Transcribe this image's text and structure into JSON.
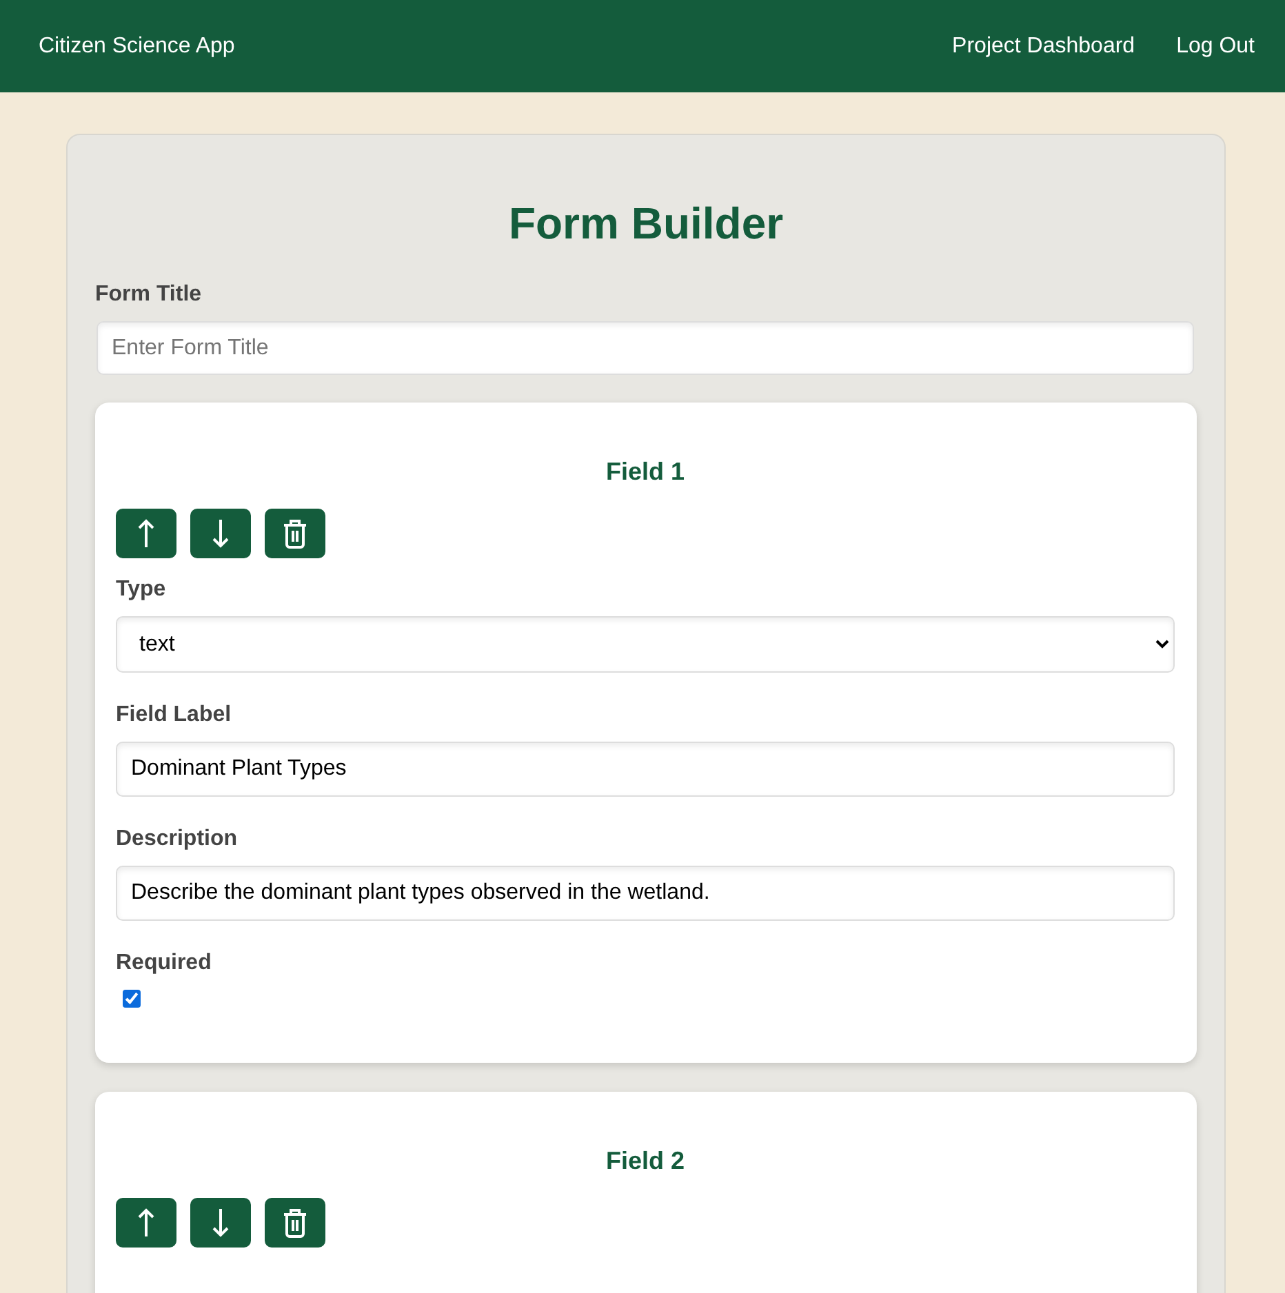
{
  "navbar": {
    "brand": "Citizen Science App",
    "links": [
      "Project Dashboard",
      "Log Out"
    ]
  },
  "title": "Form Builder",
  "form_title": {
    "label": "Form Title",
    "placeholder": "Enter Form Title"
  },
  "fields": [
    {
      "heading": "Field 1",
      "type": {
        "label": "Type",
        "value": "text"
      },
      "field_label": {
        "label": "Field Label",
        "value": "Dominant Plant Types"
      },
      "description": {
        "label": "Description",
        "value": "Describe the dominant plant types observed in the wetland."
      },
      "required": {
        "label": "Required",
        "checked": true
      }
    },
    {
      "heading": "Field 2"
    }
  ]
}
